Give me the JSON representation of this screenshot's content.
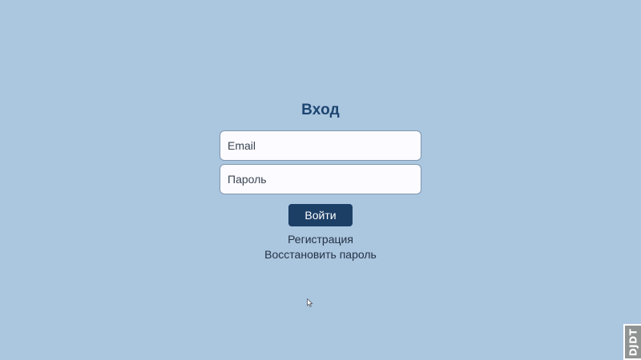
{
  "login": {
    "title": "Вход",
    "email_placeholder": "Email",
    "password_placeholder": "Пароль",
    "submit_label": "Войти",
    "register_link": "Регистрация",
    "restore_link": "Восстановить пароль"
  },
  "debug_toolbar": {
    "label": "DJDT"
  },
  "colors": {
    "background": "#abc6df",
    "accent": "#1c3f66",
    "title": "#1d4571"
  },
  "icons": {
    "cursor": "mouse-pointer-icon"
  }
}
